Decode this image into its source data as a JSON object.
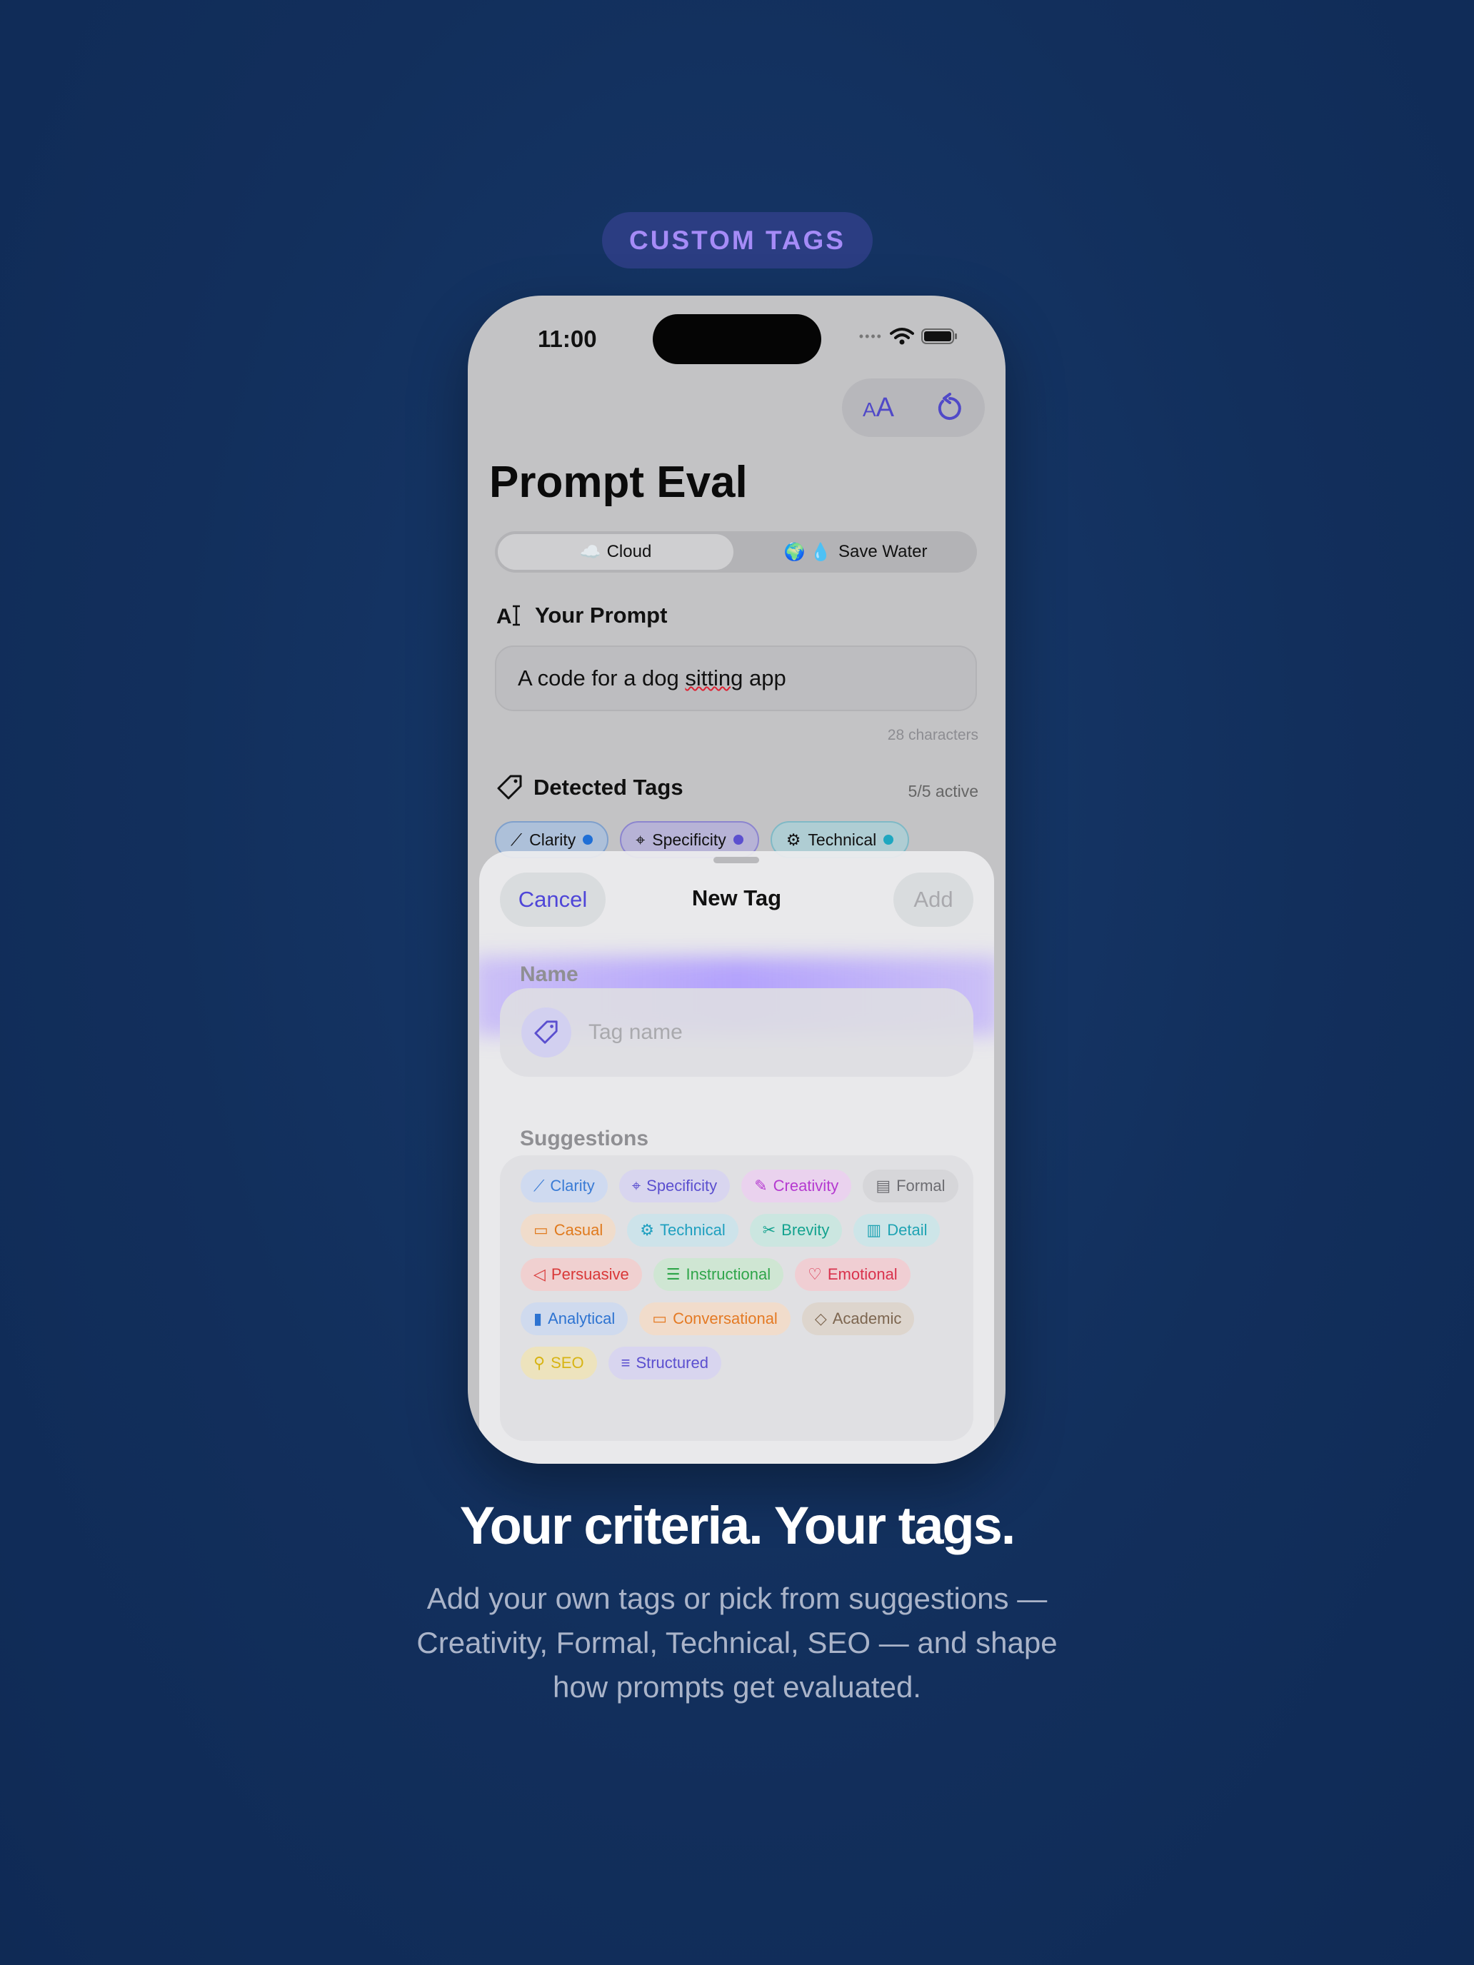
{
  "badge": "CUSTOM TAGS",
  "status_bar": {
    "time": "11:00"
  },
  "toolbar": {
    "text_size_icon": "text-size-icon",
    "reset_icon": "reset-icon"
  },
  "app": {
    "title": "Prompt Eval"
  },
  "mode_toggle": {
    "options": [
      {
        "icon": "☁️",
        "label": "Cloud",
        "selected": true
      },
      {
        "icon": "🌍 💧",
        "label": "Save Water",
        "selected": false
      }
    ]
  },
  "prompt_section": {
    "heading": "Your Prompt",
    "value_before": "A code for a dog ",
    "value_misspelled": "sitting",
    "value_after": " app",
    "char_count": "28 characters"
  },
  "detected_tags": {
    "heading": "Detected Tags",
    "count": "5/5 active",
    "tags": [
      {
        "label": "Clarity",
        "color": "#1f6fd6"
      },
      {
        "label": "Specificity",
        "color": "#5b4fcf"
      },
      {
        "label": "Technical",
        "color": "#1ea7c0"
      }
    ]
  },
  "sheet": {
    "cancel": "Cancel",
    "title": "New Tag",
    "add": "Add",
    "name_label": "Name",
    "name_placeholder": "Tag name",
    "suggestions_label": "Suggestions",
    "suggestions": [
      {
        "label": "Clarity",
        "icon": "wand-icon",
        "color": "#3a7bd5",
        "bg": "#cfdaf0"
      },
      {
        "label": "Specificity",
        "icon": "crosshair-icon",
        "color": "#5b4fcf",
        "bg": "#d8d5ef"
      },
      {
        "label": "Creativity",
        "icon": "brush-icon",
        "color": "#b53ad0",
        "bg": "#ead2ee"
      },
      {
        "label": "Formal",
        "icon": "document-icon",
        "color": "#6d6d72",
        "bg": "#d6d6d9"
      },
      {
        "label": "Casual",
        "icon": "chat-icon",
        "color": "#e07a1e",
        "bg": "#f0dccb"
      },
      {
        "label": "Technical",
        "icon": "gear-icon",
        "color": "#1e9fbf",
        "bg": "#cde3ea"
      },
      {
        "label": "Brevity",
        "icon": "scissors-icon",
        "color": "#14a38f",
        "bg": "#cbe6e0"
      },
      {
        "label": "Detail",
        "icon": "detail-icon",
        "color": "#1fa3b3",
        "bg": "#cde5e8"
      },
      {
        "label": "Persuasive",
        "icon": "megaphone-icon",
        "color": "#d93838",
        "bg": "#f0d0d0"
      },
      {
        "label": "Instructional",
        "icon": "list-icon",
        "color": "#2fa54a",
        "bg": "#cfe6d3"
      },
      {
        "label": "Emotional",
        "icon": "heart-icon",
        "color": "#d9324d",
        "bg": "#f0ced3"
      },
      {
        "label": "Analytical",
        "icon": "bars-icon",
        "color": "#2d73d1",
        "bg": "#cfdaee"
      },
      {
        "label": "Conversational",
        "icon": "bubbles-icon",
        "color": "#e47a24",
        "bg": "#f1dccb"
      },
      {
        "label": "Academic",
        "icon": "graduation-cap-icon",
        "color": "#7d6650",
        "bg": "#ddd5cd"
      },
      {
        "label": "SEO",
        "icon": "magnifier-icon",
        "color": "#d7b414",
        "bg": "#ede3bd"
      },
      {
        "label": "Structured",
        "icon": "outline-icon",
        "color": "#5b4fcf",
        "bg": "#d8d5ef"
      }
    ]
  },
  "headline": "Your criteria. Your tags.",
  "subtext": "Add your own tags or pick from suggestions — Creativity, Formal, Technical, SEO — and shape how prompts get evaluated."
}
